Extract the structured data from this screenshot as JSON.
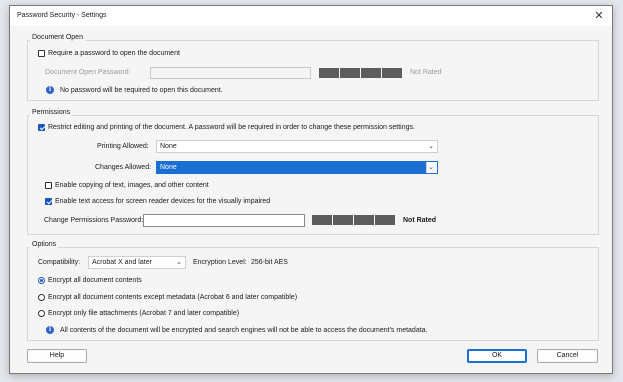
{
  "window": {
    "title": "Password Security - Settings",
    "close_glyph": "✕"
  },
  "document_open": {
    "legend": "Document Open",
    "require_password_label": "Require a password to open the document",
    "require_password_checked": false,
    "password_label": "Document Open Password:",
    "password_value": "",
    "strength_label": "Not Rated",
    "info_text": "No password will be required to open this document."
  },
  "permissions": {
    "legend": "Permissions",
    "restrict_label": "Restrict editing and printing of the document. A password will be required in order to change these permission settings.",
    "restrict_checked": true,
    "printing_label": "Printing Allowed:",
    "printing_value": "None",
    "changes_label": "Changes Allowed:",
    "changes_value": "None",
    "copy_label": "Enable copying of text, images, and other content",
    "copy_checked": false,
    "screen_reader_label": "Enable text access for screen reader devices for the visually impaired",
    "screen_reader_checked": true,
    "change_pw_label": "Change Permissions Password:",
    "change_pw_value": "",
    "strength_label": "Not Rated"
  },
  "options": {
    "legend": "Options",
    "compatibility_label": "Compatibility:",
    "compatibility_value": "Acrobat X and later",
    "encryption_label": "Encryption  Level:",
    "encryption_value": "256-bit AES",
    "radio_all": "Encrypt all document contents",
    "radio_except_meta": "Encrypt all document contents except metadata (Acrobat 6 and later compatible)",
    "radio_attachments": "Encrypt only file attachments (Acrobat 7 and later compatible)",
    "selected_radio": "all",
    "info_text": "All contents of the document will be encrypted and search engines will not be able to access the document's metadata."
  },
  "buttons": {
    "help": "Help",
    "ok": "OK",
    "cancel": "Cancel"
  },
  "icons": {
    "info": "i",
    "chevron": "⌄"
  },
  "colors": {
    "accent": "#1a6fd4",
    "meter": "#5d5d5d"
  }
}
